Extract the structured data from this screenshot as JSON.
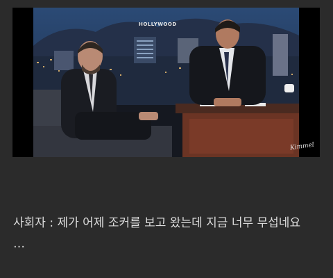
{
  "video": {
    "watermark": "Kimmel"
  },
  "caption": {
    "text": "사회자 : 제가 어제 조커를 보고 왔는데 지금 너무 무섭네요\n…"
  }
}
